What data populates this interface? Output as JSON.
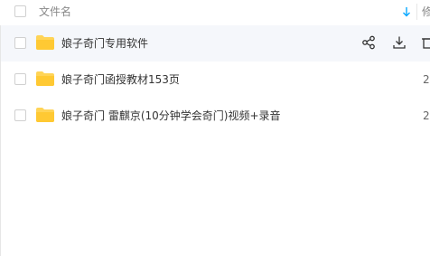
{
  "header": {
    "name_label": "文件名",
    "next_col_label": "修"
  },
  "files": [
    {
      "name": "娘子奇门专用软件",
      "next_col": "2"
    },
    {
      "name": "娘子奇门函授教材153页",
      "next_col": "2"
    },
    {
      "name": "娘子奇门 雷麒京(10分钟学会奇门)视频+录音",
      "next_col": "2"
    }
  ],
  "icons": {
    "folder": "folder-icon",
    "sort": "sort-arrow-down-icon",
    "share": "share-icon",
    "download": "download-icon",
    "more": "delete-icon"
  },
  "colors": {
    "folder": "#FFD457",
    "accent": "#06a7ff",
    "hover_row": "#f5f7fb"
  }
}
